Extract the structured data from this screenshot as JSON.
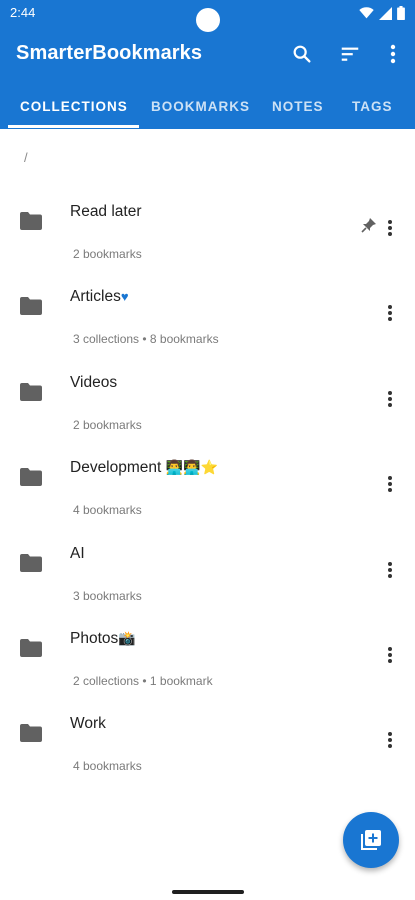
{
  "status": {
    "time": "2:44"
  },
  "app": {
    "title": "SmarterBookmarks"
  },
  "toolbar": {
    "search_icon": "search-icon",
    "sort_icon": "sort-icon",
    "overflow_icon": "more-vert-icon"
  },
  "tabs": [
    {
      "label": "COLLECTIONS",
      "active": true
    },
    {
      "label": "BOOKMARKS",
      "active": false
    },
    {
      "label": "NOTES",
      "active": false
    },
    {
      "label": "TAGS",
      "active": false
    }
  ],
  "breadcrumb": "/",
  "collections": [
    {
      "name": "Read later",
      "suffix": "",
      "info": "2 bookmarks",
      "pinned": true
    },
    {
      "name": "Articles",
      "suffix": "♥",
      "info": "3 collections • 8 bookmarks",
      "pinned": false
    },
    {
      "name": "Videos",
      "suffix": "",
      "info": "2 bookmarks",
      "pinned": false
    },
    {
      "name": "Development",
      "suffix": "👨‍💻👨‍💻⭐",
      "info": "4 bookmarks",
      "pinned": false
    },
    {
      "name": "AI",
      "suffix": "",
      "info": "3 bookmarks",
      "pinned": false
    },
    {
      "name": "Photos",
      "suffix": "📸",
      "info": "2 collections • 1 bookmark",
      "pinned": false
    },
    {
      "name": "Work",
      "suffix": "",
      "info": "4 bookmarks",
      "pinned": false
    }
  ],
  "fab": {
    "icon": "add-collection-icon"
  },
  "colors": {
    "primary": "#1976d2",
    "folder": "#616161"
  }
}
